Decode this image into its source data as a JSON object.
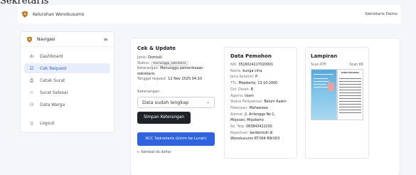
{
  "page_heading": "Sekretaris",
  "topbar": {
    "brand_name": "Kelurahan Wonokusumo",
    "user_name": "Sekretaris Demo"
  },
  "sidebar": {
    "title": "Navigasi",
    "items": [
      {
        "icon": "chart-icon",
        "glyph": "ılı",
        "label": "Dashboard"
      },
      {
        "icon": "checklist-icon",
        "glyph": "☑",
        "label": "Cek Request"
      },
      {
        "icon": "printer-icon",
        "glyph": "⎙",
        "label": "Cetak Surat"
      },
      {
        "icon": "star-icon",
        "glyph": "☆",
        "label": "Surat Selesai"
      },
      {
        "icon": "people-icon",
        "glyph": "⚇",
        "label": "Data Warga"
      }
    ],
    "logout": {
      "icon": "door-icon",
      "glyph": "▯",
      "label": "Logout"
    }
  },
  "cek_update": {
    "title": "Cek & Update",
    "jenis_label": "Jenis:",
    "jenis_value": "Domisili",
    "status_label": "Status:",
    "status_value": "menunggu_sekretaris",
    "keterangan_label": "Keterangan:",
    "keterangan_value": "Menunggu pemeriksaan sekretaris",
    "tanggal_label": "Tanggal request:",
    "tanggal_value": "12 Nov 2025 04:10",
    "select_label": "Keterangan",
    "select_value": "Data sudah lengkap",
    "save_label": "Simpan Keterangan",
    "acc_label": "ACC Sekretaris (kirim ke Lurah)",
    "back_label": "← Kembali ke daftar"
  },
  "data_pemohon": {
    "title": "Data Pemohon",
    "rows": [
      {
        "label": "NIK:",
        "value": "3516024217020001"
      },
      {
        "label": "Nama:",
        "value": "bunga citra"
      },
      {
        "label": "Jenis Kelamin:",
        "value": "P"
      },
      {
        "label": "TTL:",
        "value": "Mojokerto, 13-10-2000"
      },
      {
        "label": "Gol. Darah:",
        "value": "B"
      },
      {
        "label": "Agama:",
        "value": "Islam"
      },
      {
        "label": "Status Perkawinan:",
        "value": "Belum Kawin"
      },
      {
        "label": "Pekerjaan:",
        "value": "Mahasiswa"
      },
      {
        "label": "Alamat:",
        "value": "Jl. Airlangga No.1, Mojosari, Mojokerto"
      },
      {
        "label": "No. Telp:",
        "value": "083843422200"
      },
      {
        "label": "Keperluan:",
        "value": "berdomisili di Wonokusumo RT.004 RW.003"
      }
    ]
  },
  "lampiran": {
    "title": "Lampiran",
    "ktp_label": "Scan KTP",
    "kk_label": "Scan KK",
    "kk_caption": "KARTU KELUARGA"
  },
  "colors": {
    "accent": "#2f63e0",
    "dark_button": "#1f2329",
    "active_nav_bg": "#e9eefc"
  }
}
